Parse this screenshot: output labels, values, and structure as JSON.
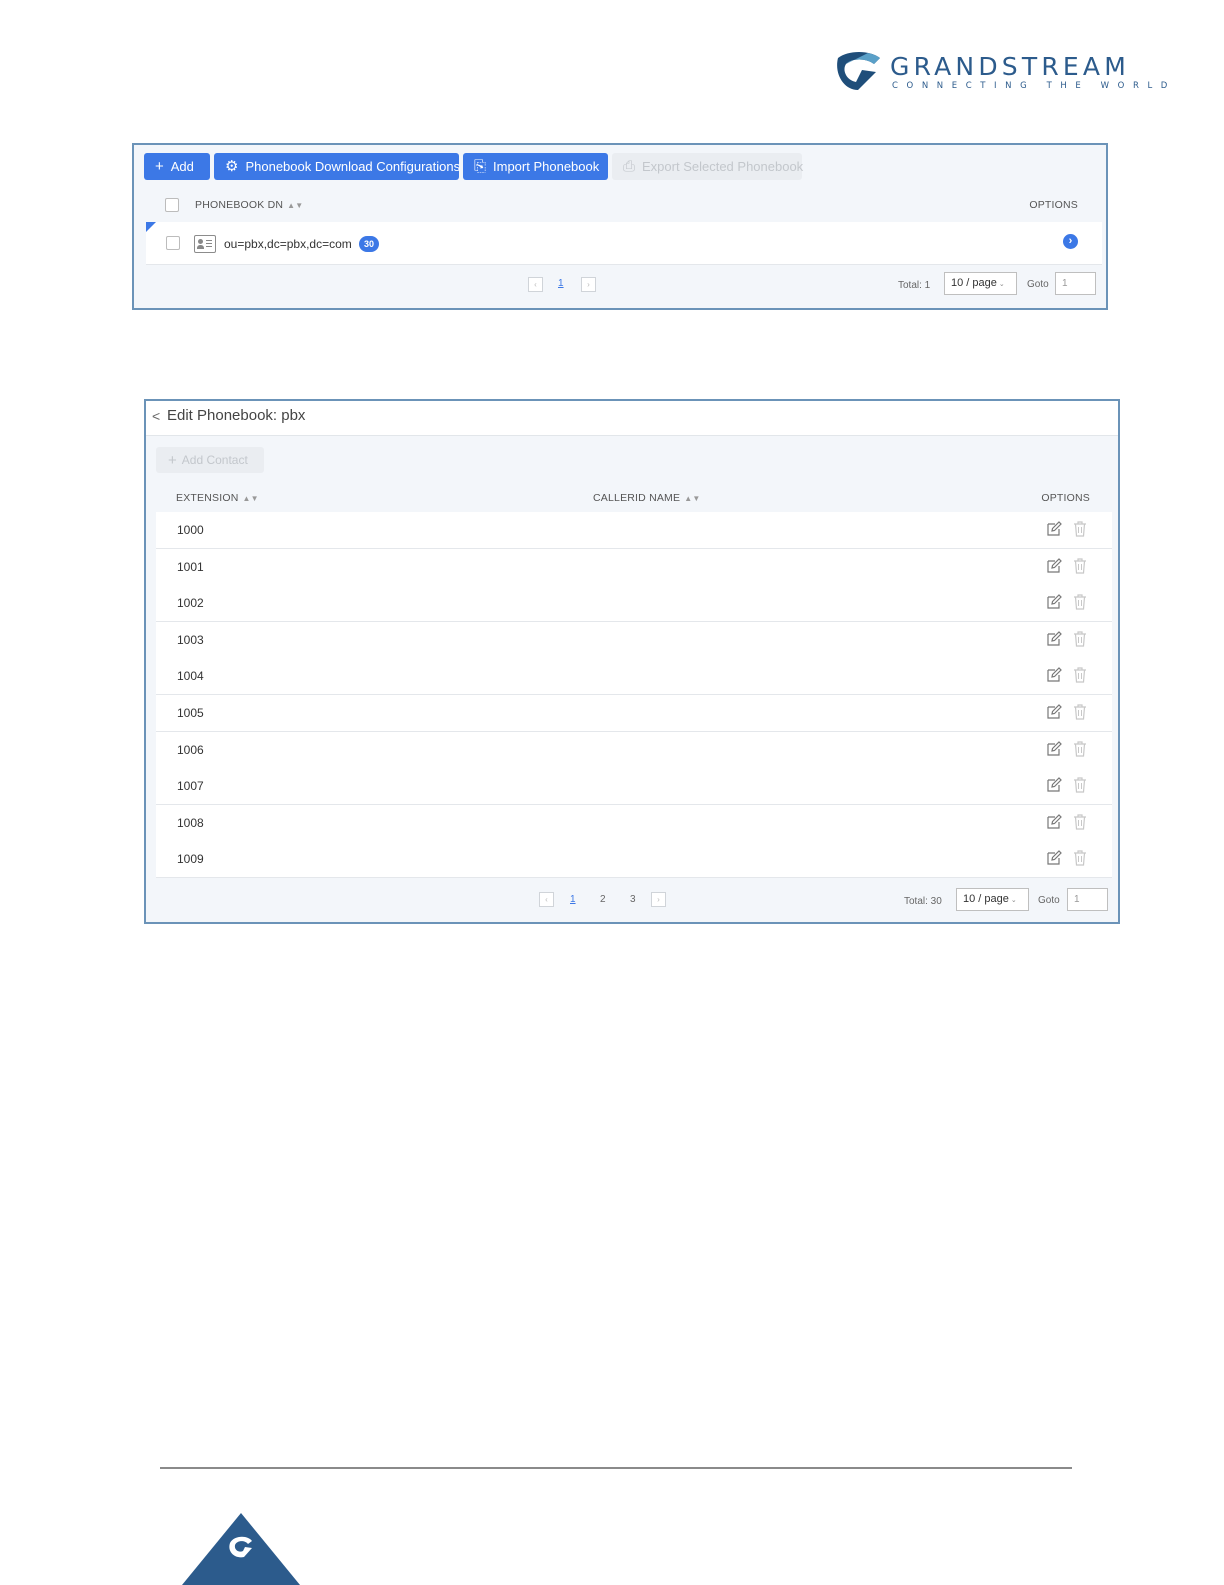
{
  "brand": {
    "name": "GRANDSTREAM",
    "tagline": "CONNECTING THE WORLD",
    "color": "#2c5b8c"
  },
  "phonebook_list": {
    "toolbar": {
      "add": "Add",
      "download_config": "Phonebook Download Configurations",
      "import": "Import Phonebook",
      "export": "Export Selected Phonebook"
    },
    "columns": {
      "dn": "PHONEBOOK DN",
      "options": "OPTIONS"
    },
    "rows": [
      {
        "dn": "ou=pbx,dc=pbx,dc=com",
        "count": "30"
      }
    ],
    "pagination": {
      "pages": [
        "1"
      ],
      "current": "1",
      "total": "Total: 1",
      "page_size": "10 / page",
      "goto_label": "Goto",
      "goto_value": "1"
    }
  },
  "edit_phonebook": {
    "title": "Edit Phonebook: pbx",
    "add_contact": "Add Contact",
    "columns": {
      "extension": "EXTENSION",
      "callerid": "CALLERID NAME",
      "options": "OPTIONS"
    },
    "rows": [
      {
        "extension": "1000",
        "callerid": ""
      },
      {
        "extension": "1001",
        "callerid": ""
      },
      {
        "extension": "1002",
        "callerid": ""
      },
      {
        "extension": "1003",
        "callerid": ""
      },
      {
        "extension": "1004",
        "callerid": ""
      },
      {
        "extension": "1005",
        "callerid": ""
      },
      {
        "extension": "1006",
        "callerid": ""
      },
      {
        "extension": "1007",
        "callerid": ""
      },
      {
        "extension": "1008",
        "callerid": ""
      },
      {
        "extension": "1009",
        "callerid": ""
      }
    ],
    "pagination": {
      "pages": [
        "1",
        "2",
        "3"
      ],
      "current": "1",
      "total": "Total: 30",
      "page_size": "10 / page",
      "goto_label": "Goto",
      "goto_value": "1"
    }
  },
  "colors": {
    "primary": "#3c78e6",
    "panel_border": "#6b93b8",
    "panel_bg": "#f3f6fa",
    "disabled": "#c3c7cc"
  },
  "icons": [
    "plus-icon",
    "gear-icon",
    "import-icon",
    "export-icon",
    "phonebook-icon",
    "arrow-right-circle-icon",
    "edit-icon",
    "trash-icon",
    "chevron-left-icon"
  ]
}
